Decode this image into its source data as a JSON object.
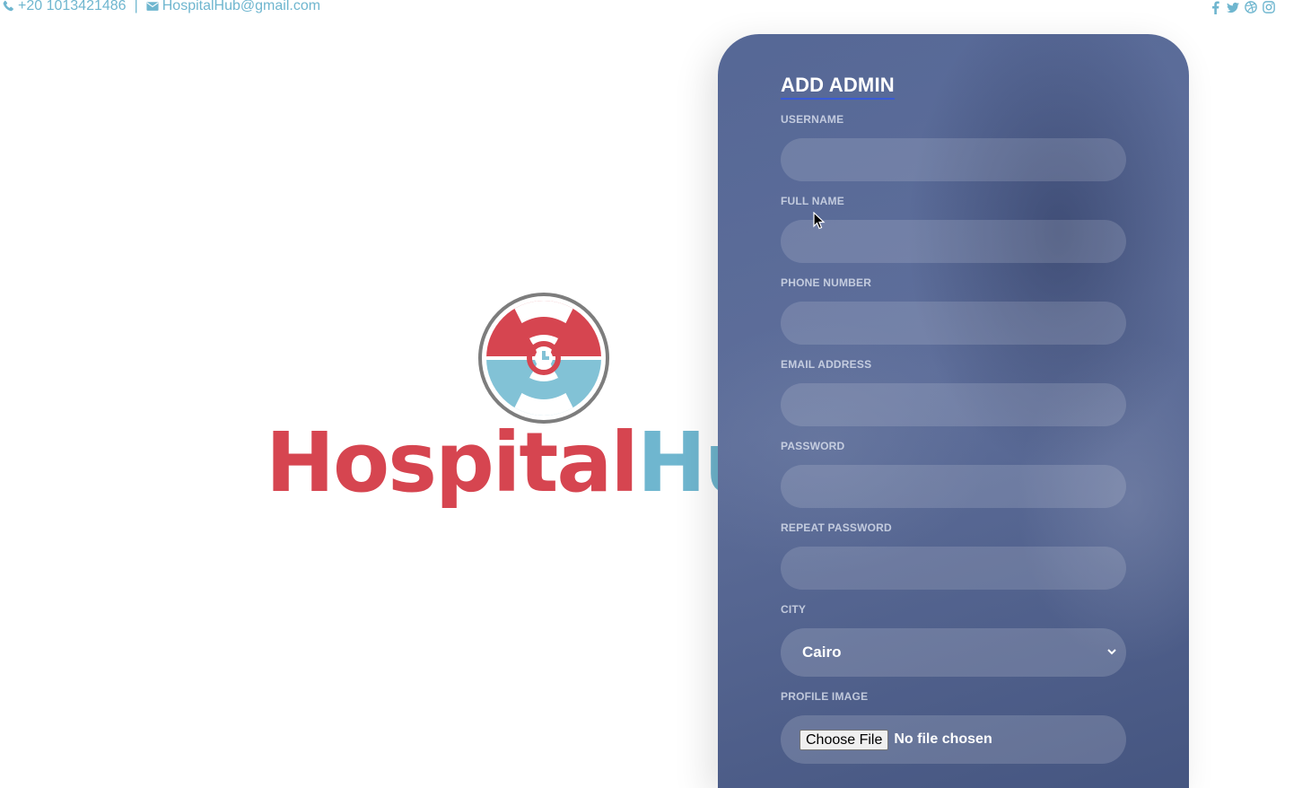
{
  "topbar": {
    "phone": "+20 1013421486",
    "separator": "|",
    "email": "HospitalHub@gmail.com",
    "socials": [
      "facebook-icon",
      "twitter-icon",
      "dribbble-icon",
      "instagram-icon"
    ]
  },
  "logo": {
    "part1": "Hospital",
    "part2": "Hub",
    "color_red": "#d64550",
    "color_blue": "#6fb6cf"
  },
  "form": {
    "title": "ADD ADMIN",
    "fields": {
      "username": {
        "label": "USERNAME",
        "value": ""
      },
      "full_name": {
        "label": "FULL NAME",
        "value": ""
      },
      "phone": {
        "label": "PHONE NUMBER",
        "value": ""
      },
      "email": {
        "label": "EMAIL ADDRESS",
        "value": ""
      },
      "password": {
        "label": "PASSWORD",
        "value": ""
      },
      "repeat_password": {
        "label": "REPEAT PASSWORD",
        "value": ""
      },
      "city": {
        "label": "CITY",
        "selected": "Cairo"
      },
      "profile_image": {
        "label": "PROFILE IMAGE",
        "button": "Choose File",
        "status": "No file chosen"
      }
    },
    "accent_color": "#3a5bd6"
  }
}
